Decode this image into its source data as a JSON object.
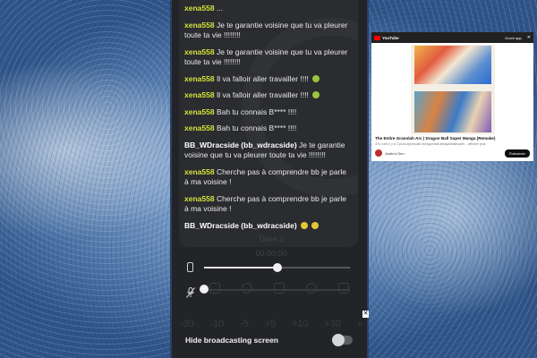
{
  "chat": {
    "messages": [
      {
        "user": "xena558",
        "text": "..."
      },
      {
        "user": "xena558",
        "text": "Je te garantie voisine que tu va pleurer toute ta vie !!!!!!!!"
      },
      {
        "user": "xena558",
        "text": "Je te garantie voisine que tu va pleurer toute ta vie !!!!!!!!"
      },
      {
        "user": "xena558",
        "text": "Il va falloir aller travailler !!!!"
      },
      {
        "user": "xena558",
        "text": "Il va falloir aller travailler !!!!"
      },
      {
        "user": "xena558",
        "text": "Bah tu connais B**** !!!!"
      },
      {
        "user": "xena558",
        "text": "Bah tu connais B**** !!!!"
      },
      {
        "user": "BB_WDracside (bb_wdracside)",
        "text": "Je te garantie voisine que tu va pleurer toute ta vie !!!!!!!!"
      },
      {
        "user": "xena558",
        "text": "Cherche pas à comprendre bb je parle à ma voisine !"
      },
      {
        "user": "xena558",
        "text": "Cherche pas à comprendre bb je parle à ma voisine !"
      },
      {
        "user": "BB_WDracside (bb_wdracside)",
        "text": ""
      }
    ],
    "emoji_color": "#e4c43a",
    "username_color": "#d4e23a"
  },
  "controls": {
    "volume_level": 0.5,
    "mic_level": 0.0,
    "seek_labels": [
      "-30",
      "-10",
      "-5",
      "+5",
      "+10",
      "+30",
      "+"
    ],
    "hide_broadcast_label": "Hide broadcasting screen",
    "hide_broadcast_enabled": false,
    "ghost_text_1": "Diwa 2",
    "ghost_text_2": "00:00:00"
  },
  "youtube": {
    "brand": "YouTube",
    "open_app": "Ouvrir app",
    "title": "The Entire Granolah Arc | Dragon Ball Super Manga (Remake)",
    "meta": "37k vues  il y a 3 jours  #granolah #dragonball #dragonballsuper   ...afficher plus",
    "channel": "Justin's Den",
    "subscribe": "S'abonner"
  }
}
